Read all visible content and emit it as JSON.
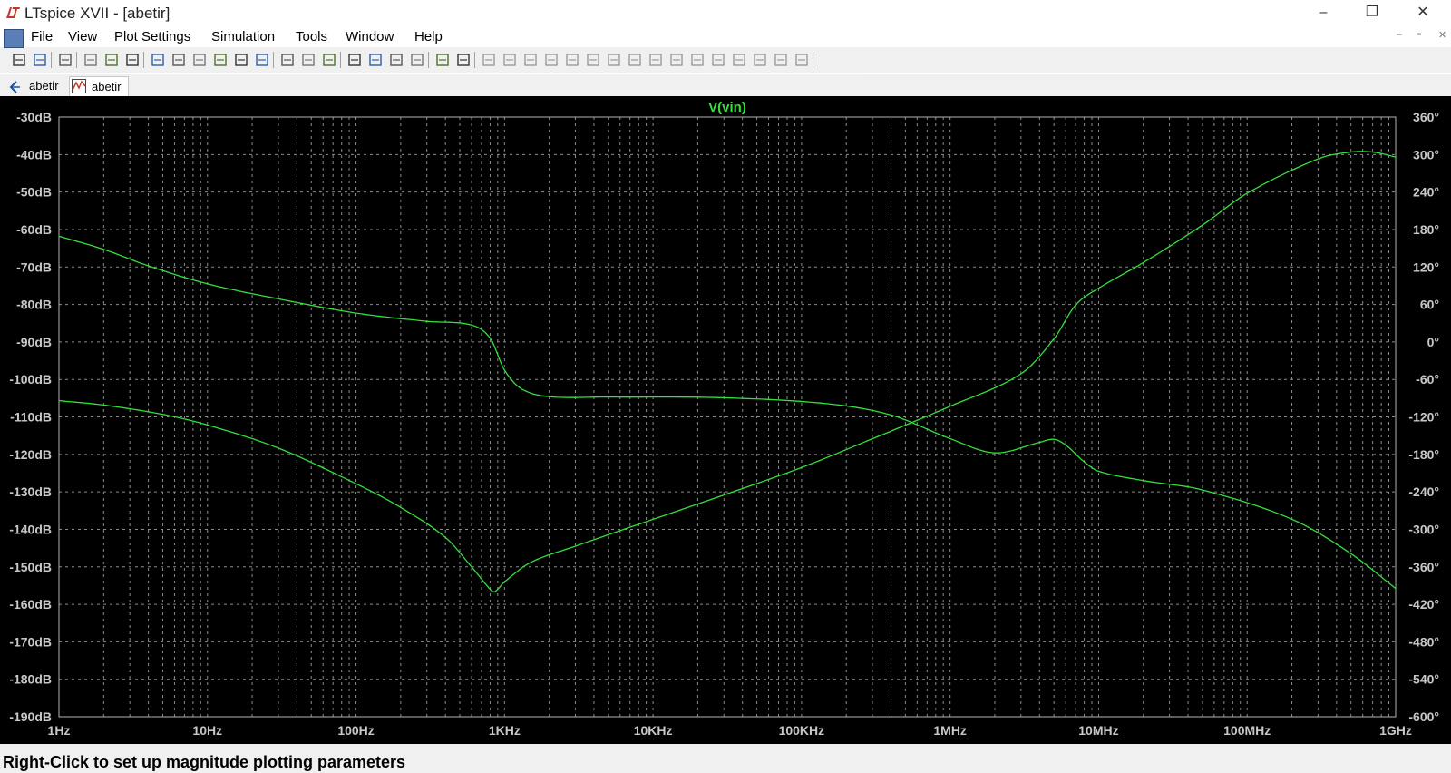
{
  "window": {
    "title": "LTspice XVII - [abetir]",
    "controls": [
      "–",
      "❐",
      "✕"
    ]
  },
  "menu": {
    "items": [
      "File",
      "View",
      "Plot Settings",
      "Simulation",
      "Tools",
      "Window",
      "Help"
    ],
    "mdi_controls": [
      "–",
      "▫",
      "✕"
    ]
  },
  "toolbar": {
    "icons": [
      "new-schematic-icon",
      "open-icon",
      "save-icon",
      "control-panel-icon",
      "run-icon",
      "halt-icon",
      "zoom-in-icon",
      "zoom-out-icon",
      "zoom-full-icon",
      "zoom-cancel-icon",
      "autorange-icon",
      "plot-settings-icon",
      "tile-horizontal-icon",
      "cascade-icon",
      "tile-vertical-icon",
      "cut-icon",
      "copy-icon",
      "paste-icon",
      "find-icon",
      "print-preview-icon",
      "print-icon",
      "wire-icon",
      "ground-icon",
      "label-icon",
      "resistor-icon",
      "capacitor-icon",
      "inductor-icon",
      "diode-icon",
      "component-icon",
      "move-icon",
      "drag-icon",
      "undo-icon",
      "redo-icon",
      "rotate-icon",
      "mirror-icon",
      "text-icon",
      "spice-directive-icon"
    ]
  },
  "tabs": [
    {
      "label": "abetir",
      "icon": "schematic-icon"
    },
    {
      "label": "abetir",
      "icon": "waveform-icon"
    }
  ],
  "status": {
    "text": "Right-Click to set up magnitude plotting parameters"
  },
  "colors": {
    "plot_background": "#000000",
    "trace": "#33e03c",
    "grid": "#8c8c8c",
    "axis_text": "#c8c8c8"
  },
  "chart_data": {
    "type": "line",
    "title": "V(vin)",
    "x_scale": "log",
    "xlim": [
      1,
      1000000000
    ],
    "x_ticks": [
      {
        "value": 1,
        "label": "1Hz"
      },
      {
        "value": 10,
        "label": "10Hz"
      },
      {
        "value": 100,
        "label": "100Hz"
      },
      {
        "value": 1000,
        "label": "1KHz"
      },
      {
        "value": 10000,
        "label": "10KHz"
      },
      {
        "value": 100000,
        "label": "100KHz"
      },
      {
        "value": 1000000,
        "label": "1MHz"
      },
      {
        "value": 10000000,
        "label": "10MHz"
      },
      {
        "value": 100000000,
        "label": "100MHz"
      },
      {
        "value": 1000000000,
        "label": "1GHz"
      }
    ],
    "ylim_left": [
      -190,
      -30
    ],
    "y_ticks_left": [
      {
        "value": -30,
        "label": "-30dB"
      },
      {
        "value": -40,
        "label": "-40dB"
      },
      {
        "value": -50,
        "label": "-50dB"
      },
      {
        "value": -60,
        "label": "-60dB"
      },
      {
        "value": -70,
        "label": "-70dB"
      },
      {
        "value": -80,
        "label": "-80dB"
      },
      {
        "value": -90,
        "label": "-90dB"
      },
      {
        "value": -100,
        "label": "-100dB"
      },
      {
        "value": -110,
        "label": "-110dB"
      },
      {
        "value": -120,
        "label": "-120dB"
      },
      {
        "value": -130,
        "label": "-130dB"
      },
      {
        "value": -140,
        "label": "-140dB"
      },
      {
        "value": -150,
        "label": "-150dB"
      },
      {
        "value": -160,
        "label": "-160dB"
      },
      {
        "value": -170,
        "label": "-170dB"
      },
      {
        "value": -180,
        "label": "-180dB"
      },
      {
        "value": -190,
        "label": "-190dB"
      }
    ],
    "ylim_right": [
      -600,
      360
    ],
    "y_ticks_right": [
      {
        "value": 360,
        "label": "360°"
      },
      {
        "value": 300,
        "label": "300°"
      },
      {
        "value": 240,
        "label": "240°"
      },
      {
        "value": 180,
        "label": "180°"
      },
      {
        "value": 120,
        "label": "120°"
      },
      {
        "value": 60,
        "label": "60°"
      },
      {
        "value": 0,
        "label": "0°"
      },
      {
        "value": -60,
        "label": "-60°"
      },
      {
        "value": -120,
        "label": "-120°"
      },
      {
        "value": -180,
        "label": "-180°"
      },
      {
        "value": -240,
        "label": "-240°"
      },
      {
        "value": -300,
        "label": "-300°"
      },
      {
        "value": -360,
        "label": "-360°"
      },
      {
        "value": -420,
        "label": "-420°"
      },
      {
        "value": -480,
        "label": "-480°"
      },
      {
        "value": -540,
        "label": "-540°"
      },
      {
        "value": -600,
        "label": "-600°"
      }
    ],
    "grid": true,
    "series": [
      {
        "axis": "left",
        "unit": "dB",
        "x": [
          1,
          2,
          4,
          10,
          30,
          100,
          300,
          600,
          800,
          1000,
          1300,
          2000,
          5000,
          30000,
          150000,
          400000,
          1000000,
          2000000,
          4000000,
          5000000,
          6000000,
          8000000,
          10000000,
          20000000,
          50000000,
          200000000,
          500000000,
          1000000000
        ],
        "y": [
          -61.8,
          -65.3,
          -69.7,
          -74.5,
          -78.5,
          -82.3,
          -84.5,
          -85.5,
          -89,
          -97.5,
          -102.5,
          -104.6,
          -104.7,
          -104.9,
          -106.5,
          -109.5,
          -115.8,
          -119.6,
          -116.8,
          -116.0,
          -117.5,
          -122,
          -124.5,
          -127,
          -129.5,
          -137.3,
          -146.5,
          -155.8
        ]
      },
      {
        "axis": "right",
        "unit": "°",
        "x": [
          1,
          2,
          5,
          10,
          30,
          100,
          200,
          400,
          600,
          800,
          850,
          900,
          1000,
          1500,
          3000,
          10000,
          30000,
          100000,
          300000,
          1000000,
          3000000,
          5000000,
          7000000,
          10000000,
          20000000,
          50000000,
          100000000,
          300000000,
          500000000,
          700000000,
          1000000000
        ],
        "y": [
          -94,
          -101,
          -116,
          -133,
          -170,
          -227,
          -265,
          -313,
          -360,
          -396,
          -400,
          -396,
          -384,
          -353,
          -327,
          -284,
          -245,
          -201,
          -155,
          -103,
          -51,
          5,
          59,
          86,
          127,
          187,
          238,
          293,
          304,
          304,
          296
        ]
      }
    ]
  }
}
